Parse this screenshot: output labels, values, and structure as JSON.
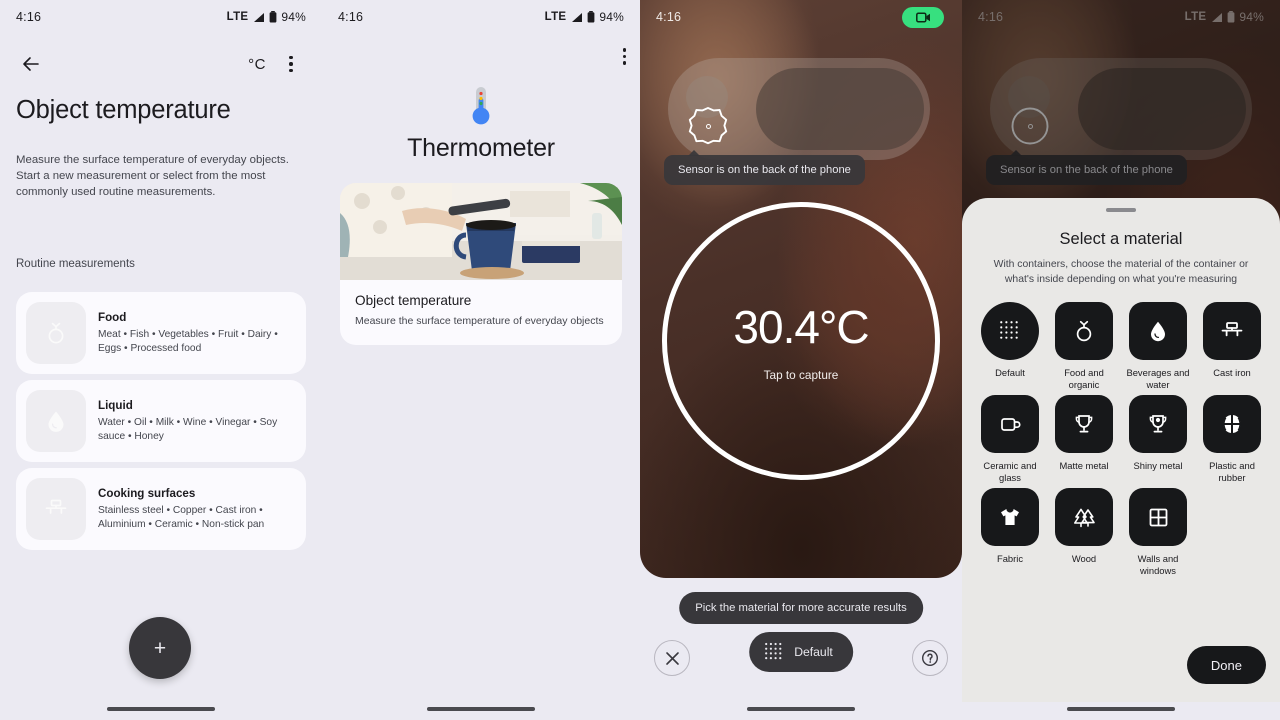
{
  "status_bar": {
    "time": "4:16",
    "network": "LTE",
    "battery": "94%"
  },
  "panel1": {
    "back_icon": "arrow-left-icon",
    "unit_toggle": "°C",
    "overflow_icon": "more-vert-icon",
    "title": "Object temperature",
    "description": "Measure the surface temperature of everyday objects. Start a new measurement or select from the most commonly used routine measurements.",
    "section_label": "Routine measurements",
    "cards": [
      {
        "icon": "food-icon",
        "title": "Food",
        "desc": "Meat • Fish • Vegetables • Fruit • Dairy • Eggs • Processed food"
      },
      {
        "icon": "droplet-icon",
        "title": "Liquid",
        "desc": "Water • Oil • Milk • Wine • Vinegar • Soy sauce • Honey"
      },
      {
        "icon": "cooktop-icon",
        "title": "Cooking surfaces",
        "desc": "Stainless steel • Copper • Cast iron • Aluminium • Ceramic • Non-stick pan"
      }
    ],
    "fab": {
      "icon": "plus-icon",
      "label": "+"
    }
  },
  "panel2": {
    "overflow_icon": "more-vert-icon",
    "app_icon": "thermometer-icon",
    "app_title": "Thermometer",
    "card": {
      "image_alt": "person measuring a blue mug with a phone",
      "title": "Object temperature",
      "desc": "Measure the surface temperature of everyday objects"
    }
  },
  "panel3": {
    "recording_icon": "camcorder-icon",
    "tooltip": "Sensor is on the back of the phone",
    "sensor_icon": "sensor-target-icon",
    "reading": "30.4°C",
    "capture_hint": "Tap to capture",
    "bottom_hint": "Pick the material for more accurate results",
    "close_icon": "close-icon",
    "help_icon": "help-circle-icon",
    "material_chip": {
      "icon": "dot-grid-icon",
      "label": "Default"
    }
  },
  "panel4": {
    "tooltip": "Sensor is on the back of the phone",
    "sheet_title": "Select a material",
    "sheet_subtitle": "With containers, choose the material of the container or what's inside depending on what you're measuring",
    "materials": [
      {
        "label": "Default",
        "icon": "dot-grid-icon",
        "selected": true
      },
      {
        "label": "Food and organic",
        "icon": "food-icon",
        "selected": false
      },
      {
        "label": "Beverages and water",
        "icon": "droplet-icon",
        "selected": false
      },
      {
        "label": "Cast iron",
        "icon": "cooktop-icon",
        "selected": false
      },
      {
        "label": "Ceramic and glass",
        "icon": "mug-icon",
        "selected": false
      },
      {
        "label": "Matte metal",
        "icon": "trophy-icon",
        "selected": false
      },
      {
        "label": "Shiny metal",
        "icon": "trophy-shine-icon",
        "selected": false
      },
      {
        "label": "Plastic and rubber",
        "icon": "basketball-icon",
        "selected": false
      },
      {
        "label": "Fabric",
        "icon": "tshirt-icon",
        "selected": false
      },
      {
        "label": "Wood",
        "icon": "trees-icon",
        "selected": false
      },
      {
        "label": "Walls and windows",
        "icon": "window-icon",
        "selected": false
      }
    ],
    "done_label": "Done"
  },
  "colors": {
    "background": "#ebeaf2",
    "surface": "#fbfafe",
    "tile": "#17181a",
    "accent_green": "#37e07f",
    "sheet": "#e9e8e6"
  }
}
